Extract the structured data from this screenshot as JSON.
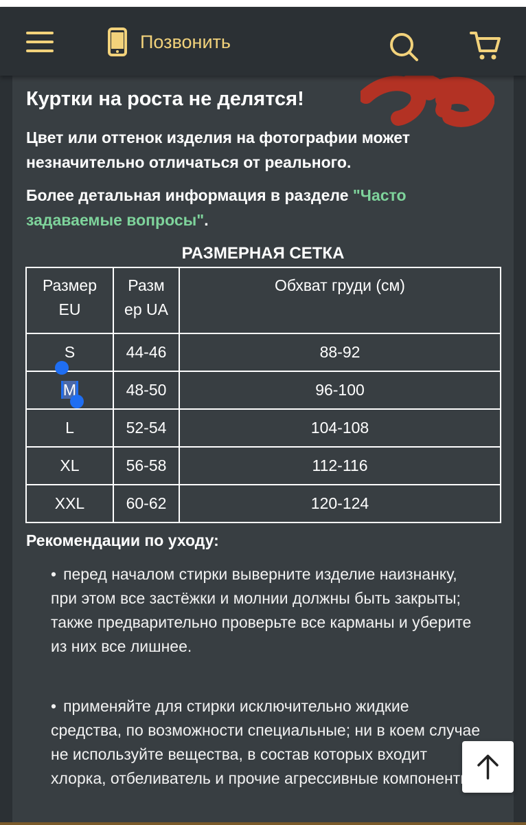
{
  "header": {
    "call_label": "Позвонить",
    "icons": [
      "menu-icon",
      "phone-icon",
      "search-icon",
      "cart-icon"
    ],
    "accent_color": "#f2d27b"
  },
  "content": {
    "heading": "Куртки на роста не делятся!",
    "color_note": "Цвет или оттенок изделия на фотографии может незначительно отличаться от реального.",
    "info_prefix": "Более детальная информация в разделе ",
    "info_link": "\"Часто задаваемые вопросы\"",
    "info_suffix": ".",
    "link_color": "#7ed39b"
  },
  "size_table": {
    "title": "РАЗМЕРНАЯ СЕТКА",
    "headers": [
      "Размер EU",
      "Разм ер UA",
      "Обхват груди (см)"
    ],
    "rows": [
      {
        "eu": "S",
        "ua": "44-46",
        "chest": "88-92"
      },
      {
        "eu": "M",
        "ua": "48-50",
        "chest": "96-100"
      },
      {
        "eu": "L",
        "ua": "52-54",
        "chest": "104-108"
      },
      {
        "eu": "XL",
        "ua": "56-58",
        "chest": "112-116"
      },
      {
        "eu": "XXL",
        "ua": "60-62",
        "chest": "120-124"
      }
    ],
    "selected_text": "M"
  },
  "care": {
    "title": "Рекомендации по уходу:",
    "items": [
      "перед началом стирки выверните изделие наизнанку, при этом все застёжки и молнии должны быть закрыты; также предварительно проверьте все карманы и уберите из них все лишнее.",
      "применяйте для стирки исключительно жидкие средства, по возможности специальные; ни в коем случае не используйте вещества, в состав которых входит хлорка, отбеливатель и прочие агрессивные компоненты;"
    ]
  },
  "scroll_top_icon": "arrow-up-icon"
}
